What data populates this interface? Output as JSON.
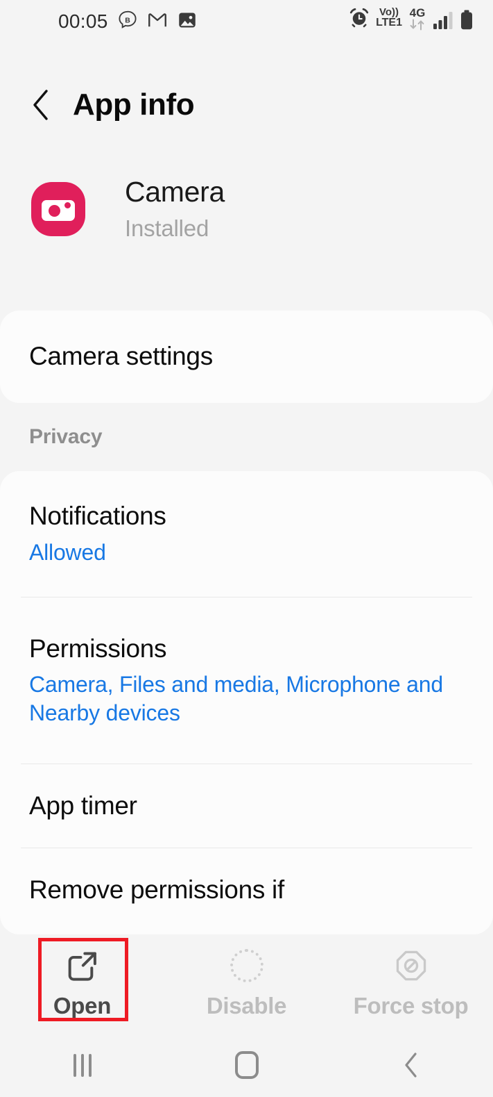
{
  "status_bar": {
    "time": "00:05",
    "left_icons": [
      "chat-bubble-b-icon",
      "gmail-icon",
      "photos-icon"
    ],
    "volte_line1": "Vo))",
    "volte_line2": "LTE1",
    "network": "4G",
    "right_icons": [
      "alarm-icon",
      "volte-icon",
      "data-transfer-icon",
      "signal-bars-icon",
      "battery-icon"
    ]
  },
  "header": {
    "title": "App info",
    "back_icon": "chevron-left-icon"
  },
  "app": {
    "name": "Camera",
    "status": "Installed",
    "icon": "camera-app-icon",
    "icon_color": "#e01f5b"
  },
  "settings_card": {
    "label": "Camera settings"
  },
  "privacy": {
    "section_label": "Privacy",
    "items": [
      {
        "title": "Notifications",
        "subtitle": "Allowed"
      },
      {
        "title": "Permissions",
        "subtitle": "Camera, Files and media, Microphone and Nearby devices"
      },
      {
        "title": "App timer",
        "subtitle": ""
      },
      {
        "title": "Remove permissions if",
        "subtitle": ""
      }
    ]
  },
  "actions": [
    {
      "label": "Open",
      "icon": "external-link-icon",
      "enabled": true
    },
    {
      "label": "Disable",
      "icon": "dotted-circle-icon",
      "enabled": false
    },
    {
      "label": "Force stop",
      "icon": "octagon-block-icon",
      "enabled": false
    }
  ],
  "navigation": {
    "recents": "recents-icon",
    "home": "home-icon",
    "back": "back-icon"
  },
  "colors": {
    "accent_link": "#1878e4",
    "highlight_box": "#ee1b24",
    "page_background": "#f4f4f4",
    "card_background": "#fcfcfc"
  }
}
